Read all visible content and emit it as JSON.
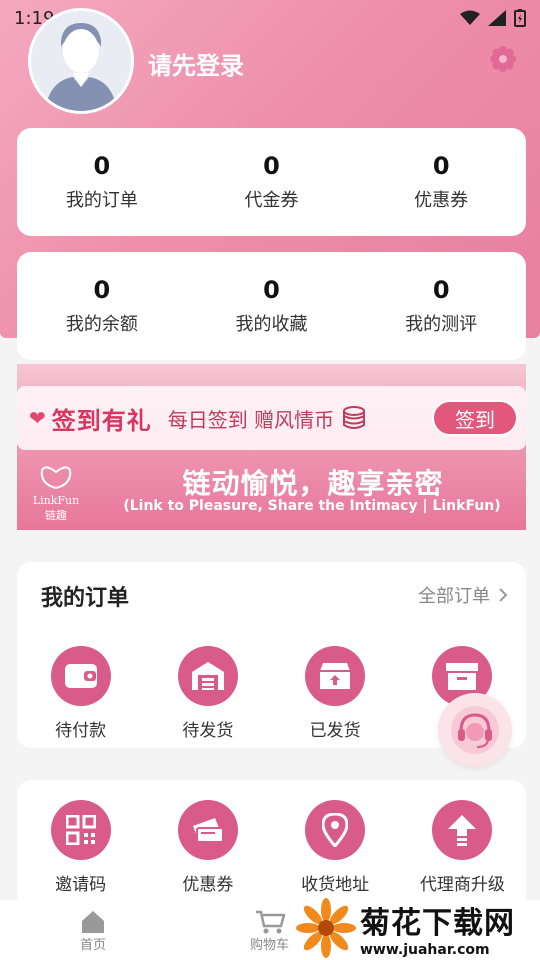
{
  "status_bar": {
    "time": "1:19"
  },
  "profile": {
    "login_text": "请先登录"
  },
  "stats_top": [
    {
      "value": "0",
      "label": "我的订单"
    },
    {
      "value": "0",
      "label": "代金券"
    },
    {
      "value": "0",
      "label": "优惠券"
    }
  ],
  "stats_bottom": [
    {
      "value": "0",
      "label": "我的余额"
    },
    {
      "value": "0",
      "label": "我的收藏"
    },
    {
      "value": "0",
      "label": "我的测评"
    }
  ],
  "banner": {
    "title": "签到有礼",
    "subtitle": "每日签到 赠风情币",
    "button": "签到",
    "logo_en": "LinkFun",
    "logo_cn": "链趣",
    "slogan": "链动愉悦，趣享亲密",
    "slogan_en": "(Link to Pleasure, Share the Intimacy | LinkFun)"
  },
  "orders": {
    "title": "我的订单",
    "all_link": "全部订单",
    "items": [
      {
        "label": "待付款",
        "icon": "wallet-icon"
      },
      {
        "label": "待发货",
        "icon": "warehouse-icon"
      },
      {
        "label": "已发货",
        "icon": "shipped-box-icon"
      },
      {
        "label": "",
        "icon": "archive-box-icon"
      }
    ]
  },
  "services": {
    "items": [
      {
        "label": "邀请码",
        "icon": "qr-code-icon"
      },
      {
        "label": "优惠券",
        "icon": "coupon-icon"
      },
      {
        "label": "收货地址",
        "icon": "location-icon"
      },
      {
        "label": "代理商升级",
        "icon": "upgrade-arrow-icon"
      }
    ]
  },
  "tabbar": {
    "home": "首页",
    "cart": "购物车"
  },
  "watermark": {
    "cn": "菊花下载网",
    "url": "www.juahar.com"
  },
  "colors": {
    "accent": "#d95b8a",
    "hero": "#ee8fab"
  }
}
